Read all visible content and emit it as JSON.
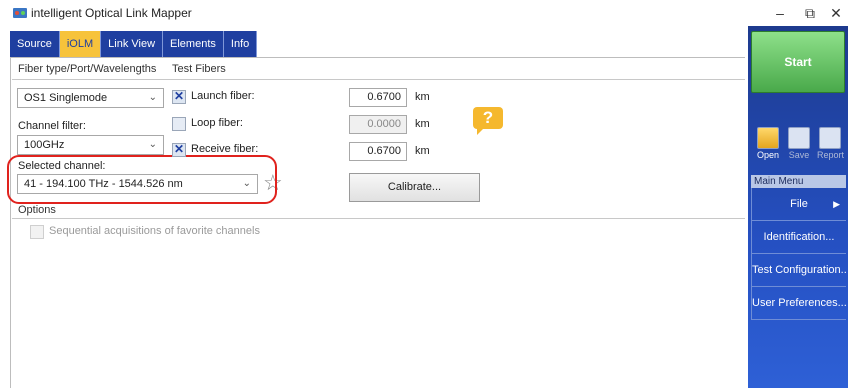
{
  "window": {
    "title": "intelligent Optical Link Mapper",
    "minimize": "–",
    "restore": "⧉",
    "close": "✕"
  },
  "tabs": [
    {
      "label": "Source"
    },
    {
      "label": "iOLM",
      "active": true
    },
    {
      "label": "Link View"
    },
    {
      "label": "Elements"
    },
    {
      "label": "Info"
    }
  ],
  "sections": {
    "fiber": "Fiber type/Port/Wavelengths",
    "test_fibers": "Test Fibers",
    "options": "Options"
  },
  "fiber_type": {
    "value": "OS1 Singlemode"
  },
  "channel_filter": {
    "label": "Channel filter:",
    "value": "100GHz"
  },
  "selected_channel": {
    "label": "Selected channel:",
    "value": "41 - 194.100 THz - 1544.526 nm"
  },
  "test_fibers": {
    "launch": {
      "label": "Launch fiber:",
      "checked": true,
      "value": "0.6700",
      "unit": "km"
    },
    "loop": {
      "label": "Loop fiber:",
      "checked": false,
      "value": "0.0000",
      "unit": "km"
    },
    "receive": {
      "label": "Receive fiber:",
      "checked": true,
      "value": "0.6700",
      "unit": "km"
    }
  },
  "calibrate_label": "Calibrate...",
  "options": {
    "sequential_label": "Sequential acquisitions of favorite channels",
    "checked": false
  },
  "help_glyph": "?",
  "favorite_glyph": "☆",
  "right_panel": {
    "start_label": "Start",
    "tools": [
      {
        "label": "Open",
        "icon": "folder-icon"
      },
      {
        "label": "Save",
        "icon": "save-icon"
      },
      {
        "label": "Report",
        "icon": "report-icon"
      }
    ],
    "main_menu_title": "Main Menu",
    "menu_items": [
      {
        "label": "File"
      },
      {
        "label": "Identification..."
      },
      {
        "label": "Test Configuration..."
      },
      {
        "label": "User Preferences..."
      }
    ]
  },
  "colors": {
    "tab_bg": "#1f3fa0",
    "tab_active": "#f7c33b",
    "start_green": "#49a94a",
    "highlight_red": "#e0221d",
    "panel_blue": "#2550c2"
  }
}
